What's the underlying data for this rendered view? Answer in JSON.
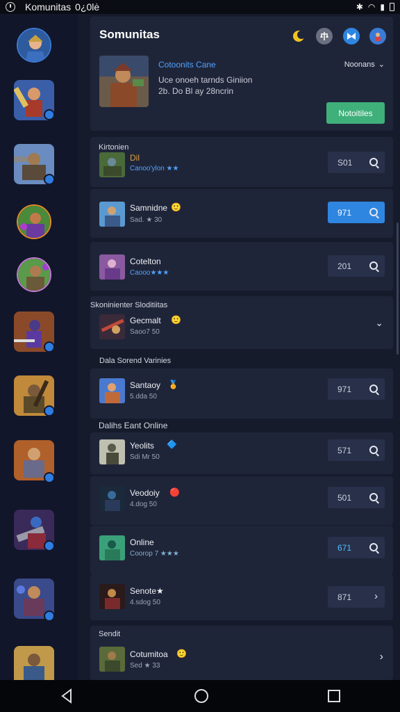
{
  "statusbar": {
    "title": "Komunitas",
    "time": "0¿0lė"
  },
  "header": {
    "title": "Somunitas",
    "featured_name": "Cotoonits Cane",
    "featured_line1": "Uce onoeh tarnds Giniion",
    "featured_line2": "2b. Do Bl ay 28ncrin",
    "sort_label": "Noonans",
    "notify_label": "Notoitiles"
  },
  "sections": [
    {
      "label": "Kirtonien"
    },
    {
      "label": "Skoninienter Sloditiitas"
    },
    {
      "label": "Dala Sorend Varinies"
    },
    {
      "label": "Dalihs Eant Online"
    },
    {
      "label": "Sendit"
    }
  ],
  "rows": [
    {
      "title": "Dil",
      "sub": "Canoo'ylon ★★",
      "value": "S01"
    },
    {
      "title": "Samnidne",
      "sub": "Sad. ★ 30",
      "value": "971"
    },
    {
      "title": "Cotelton",
      "sub": "Caooo★★★",
      "value": "201"
    },
    {
      "title": "Gecmalt",
      "sub": "Saoo7 50",
      "value": ""
    },
    {
      "title": "Santaoy",
      "sub": "5.dda 50",
      "value": "971"
    },
    {
      "title": "Yeolits",
      "sub": "Sdi Mr 50",
      "value": "571"
    },
    {
      "title": "Veodoiy",
      "sub": "4.dog 50",
      "value": "501"
    },
    {
      "title": "Online",
      "sub": "Coorop 7 ★★★",
      "value": "671"
    },
    {
      "title": "Senote★",
      "sub": "4.sdog 50",
      "value": "871"
    },
    {
      "title": "Cotumitoa",
      "sub": "Sed ★ 33",
      "value": ""
    }
  ],
  "colors": {
    "accent": "#2f86e0",
    "notify": "#3fb07a",
    "bg": "#161b2c"
  }
}
